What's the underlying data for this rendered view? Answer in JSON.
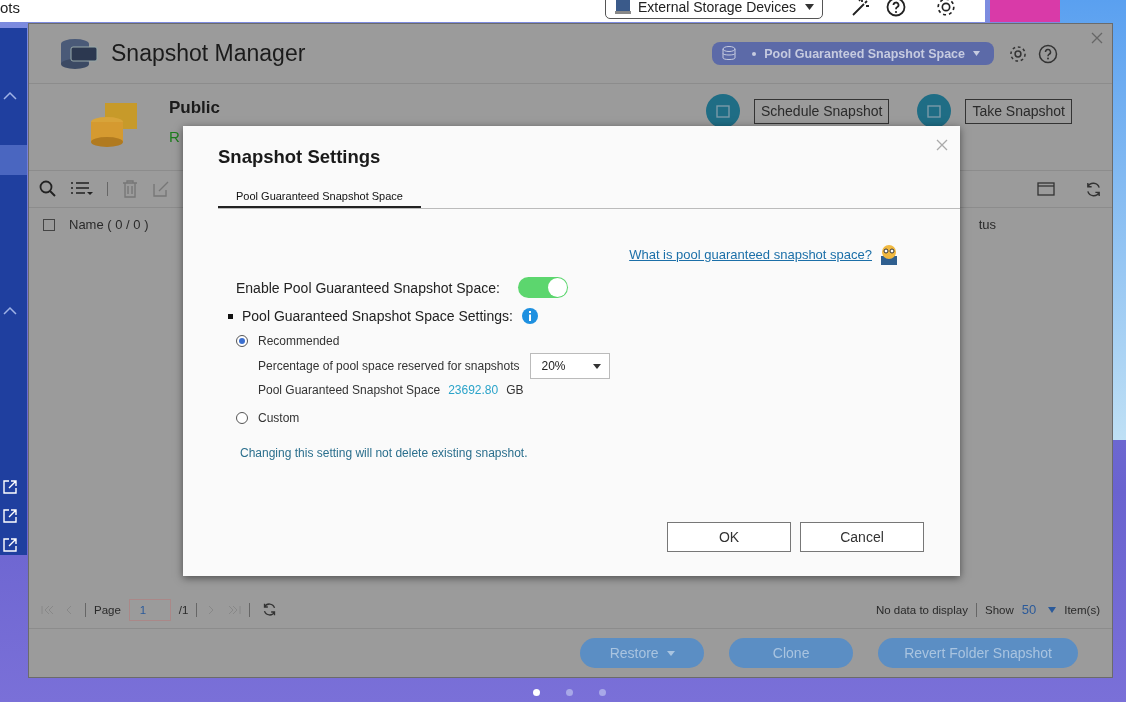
{
  "top_bar": {
    "title_fragment": "ots",
    "storage_dropdown": "External Storage Devices"
  },
  "window": {
    "title": "Snapshot Manager",
    "pool_selector": "Pool Guaranteed Snapshot Space",
    "share": {
      "name": "Public",
      "status": "R"
    },
    "actions": [
      "Schedule Snapshot",
      "Take Snapshot"
    ],
    "table": {
      "select_all_checked": false,
      "columns": [
        "Name ( 0 / 0 )",
        "tus"
      ]
    },
    "pager": {
      "label": "Page",
      "page": "1",
      "total": "/1",
      "status": "No data to display",
      "show_label": "Show",
      "per_page": "50",
      "unit": "Item(s)"
    },
    "buttons": [
      {
        "label": "Restore",
        "dropdown": true
      },
      {
        "label": "Clone",
        "dropdown": false
      },
      {
        "label": "Revert Folder Snapshot",
        "dropdown": false
      }
    ]
  },
  "dialog": {
    "title": "Snapshot Settings",
    "tabs": [
      {
        "label": "Pool Guaranteed Snapshot Space",
        "selected": true
      }
    ],
    "help_link": "What is pool guaranteed snapshot space?",
    "enable": {
      "label": "Enable Pool Guaranteed Snapshot Space:",
      "on": true
    },
    "section_label": "Pool Guaranteed Snapshot Space Settings:",
    "options": [
      {
        "label": "Recommended",
        "selected": true,
        "details": {
          "percentage_label": "Percentage of pool space reserved for snapshots",
          "percentage": "20%",
          "space_label": "Pool Guaranteed Snapshot Space",
          "space": "23692.80",
          "unit": "GB"
        }
      },
      {
        "label": "Custom",
        "selected": false
      }
    ],
    "note": "Changing this setting will not delete existing snapshot.",
    "buttons": [
      "OK",
      "Cancel"
    ]
  },
  "page_dots": [
    {
      "selected": true
    },
    {
      "selected": false
    },
    {
      "selected": false
    }
  ]
}
